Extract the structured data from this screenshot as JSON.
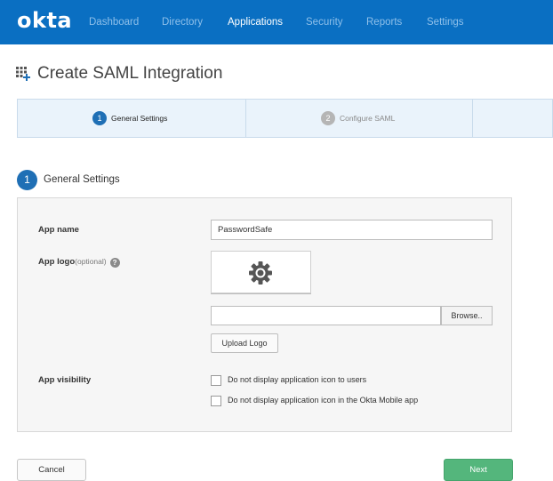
{
  "header": {
    "logo": "okta",
    "nav": [
      {
        "label": "Dashboard",
        "active": false
      },
      {
        "label": "Directory",
        "active": false
      },
      {
        "label": "Applications",
        "active": true
      },
      {
        "label": "Security",
        "active": false
      },
      {
        "label": "Reports",
        "active": false
      },
      {
        "label": "Settings",
        "active": false
      }
    ]
  },
  "page": {
    "title": "Create SAML Integration",
    "title_icon": "apps-add-icon"
  },
  "steps": [
    {
      "number": "1",
      "label": "General Settings",
      "active": true
    },
    {
      "number": "2",
      "label": "Configure SAML",
      "active": false
    }
  ],
  "section": {
    "number": "1",
    "label": "General Settings"
  },
  "form": {
    "app_name_label": "App name",
    "app_name_value": "PasswordSafe",
    "app_logo_label": "App logo",
    "app_logo_optional": "(optional)",
    "help_glyph": "?",
    "logo_placeholder_icon": "gear-icon",
    "browse_label": "Browse..",
    "upload_label": "Upload Logo",
    "visibility_label": "App visibility",
    "visibility_options": [
      {
        "label": "Do not display application icon to users",
        "checked": false
      },
      {
        "label": "Do not display application icon in the Okta Mobile app",
        "checked": false
      }
    ]
  },
  "footer": {
    "cancel_label": "Cancel",
    "next_label": "Next"
  },
  "colors": {
    "brand": "#0a6fc2",
    "step_active": "#1f6fb5",
    "next_button": "#54b67c"
  }
}
